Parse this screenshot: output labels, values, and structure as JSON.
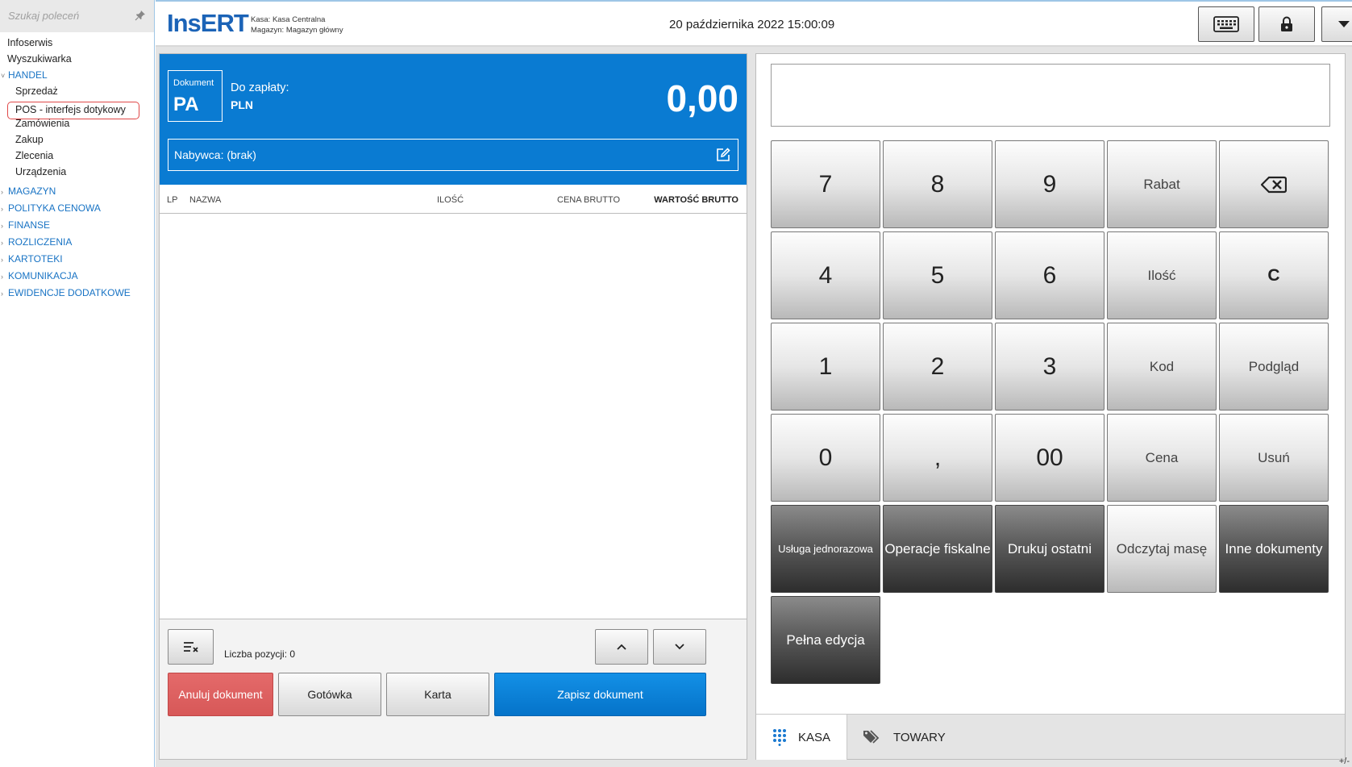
{
  "sidebar": {
    "search_placeholder": "Szukaj poleceń",
    "items": [
      {
        "label": "Infoserwis"
      },
      {
        "label": "Wyszukiwarka"
      }
    ],
    "handel": {
      "label": "HANDEL",
      "children": [
        "Sprzedaż",
        "POS - interfejs dotykowy",
        "Zamówienia",
        "Zakup",
        "Zlecenia",
        "Urządzenia"
      ]
    },
    "sections": [
      "MAGAZYN",
      "POLITYKA CENOWA",
      "FINANSE",
      "ROZLICZENIA",
      "KARTOTEKI",
      "KOMUNIKACJA",
      "EWIDENCJE DODATKOWE"
    ]
  },
  "header": {
    "logo": "InsERT",
    "kasa_label": "Kasa:",
    "kasa_value": "Kasa Centralna",
    "magazyn_label": "Magazyn:",
    "magazyn_value": "Magazyn główny",
    "datetime": "20 października 2022 15:00:09",
    "buttons": [
      {
        "icon": "keyboard-icon"
      },
      {
        "icon": "lock-icon"
      },
      {
        "icon": "chevron-down-icon"
      }
    ]
  },
  "document": {
    "type_label": "Dokument",
    "type_code": "PA",
    "to_pay_label": "Do zapłaty:",
    "currency": "PLN",
    "total": "0,00",
    "buyer": "Nabywca: (brak)",
    "columns": [
      "LP",
      "NAZWA",
      "ILOŚĆ",
      "CENA BRUTTO",
      "WARTOŚĆ BRUTTO"
    ],
    "rows": [],
    "count_label": "Liczba pozycji: 0",
    "actions": {
      "cancel": "Anuluj dokument",
      "cash": "Gotówka",
      "card": "Karta",
      "save": "Zapisz dokument"
    }
  },
  "keypad": {
    "display_value": "",
    "keys": [
      [
        "7",
        "8",
        "9",
        "Rabat",
        ""
      ],
      [
        "4",
        "5",
        "6",
        "Ilość",
        "C"
      ],
      [
        "1",
        "2",
        "3",
        "Kod",
        "Podgląd"
      ],
      [
        "0",
        ",",
        "00",
        "Cena",
        "Usuń"
      ],
      [
        "Usługa jednorazowa",
        "Operacje fiskalne",
        "Drukuj ostatni",
        "Odczytaj masę",
        "Inne dokumenty"
      ],
      [
        "Pełna edycja"
      ]
    ]
  },
  "tabs": [
    {
      "label": "KASA",
      "active": true
    },
    {
      "label": "TOWARY",
      "active": false
    }
  ],
  "footer_text": "+/-",
  "colors": {
    "accent": "#0a7bd2",
    "cancel": "#d95a5a",
    "link": "#1873c4"
  }
}
